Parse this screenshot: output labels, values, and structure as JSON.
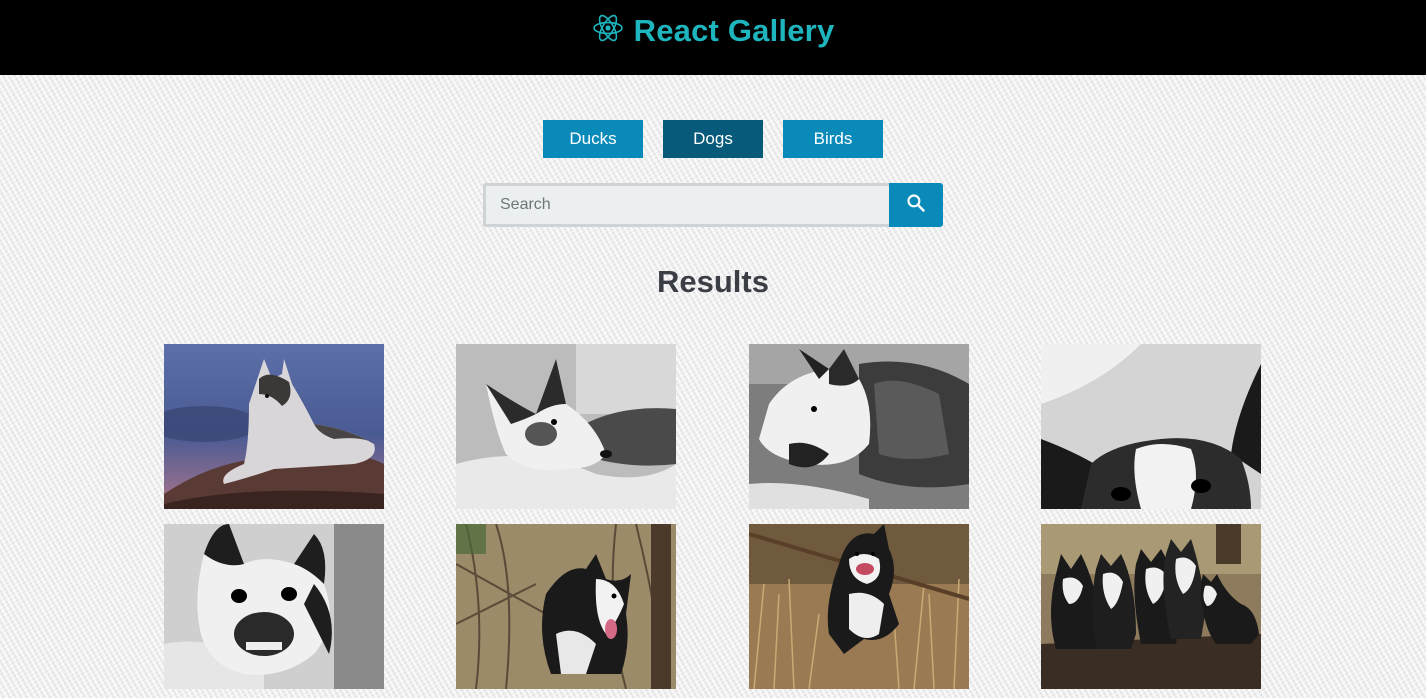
{
  "header": {
    "title": "React Gallery",
    "logo_icon": "react-atom-icon",
    "title_color": "#1fb5be"
  },
  "nav": {
    "items": [
      {
        "label": "Ducks",
        "active": false
      },
      {
        "label": "Dogs",
        "active": true
      },
      {
        "label": "Birds",
        "active": false
      }
    ],
    "button_color": "#0a8ab8",
    "active_color": "#075a7a"
  },
  "search": {
    "placeholder": "Search",
    "value": "",
    "button_icon": "search-icon"
  },
  "results": {
    "title": "Results",
    "photos": [
      {
        "subject": "husky lying on rock at dusk"
      },
      {
        "subject": "black and white dog lying on blanket"
      },
      {
        "subject": "old dog in sweater yawning"
      },
      {
        "subject": "close-up of dog ears and eyes"
      },
      {
        "subject": "dog face close-up on blanket"
      },
      {
        "subject": "border collie in bushes"
      },
      {
        "subject": "border collie carrying stick in grass"
      },
      {
        "subject": "group of border collies on dirt path"
      }
    ]
  }
}
